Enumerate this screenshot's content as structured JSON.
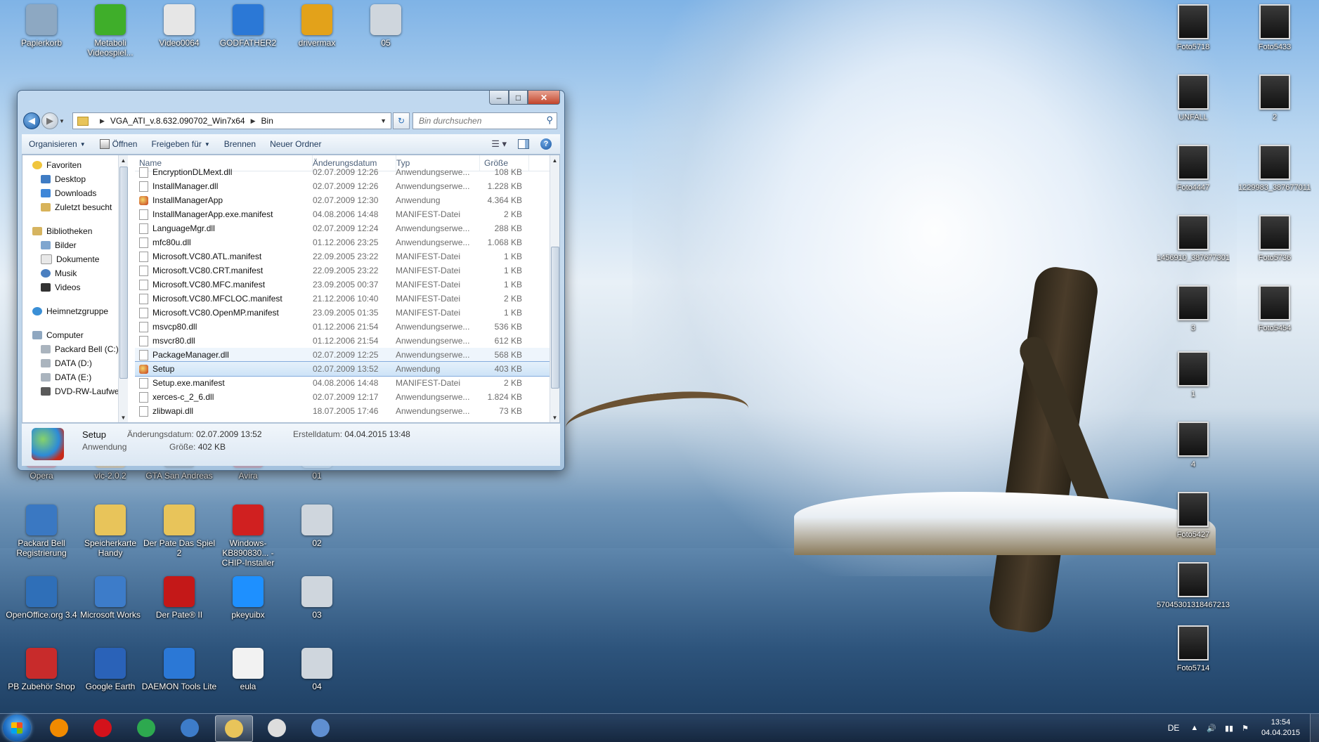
{
  "desktop": {
    "icons_left": [
      {
        "label": "Papierkorb",
        "icon": "recycle-bin-icon",
        "color": "#8da8c2"
      },
      {
        "label": "Metaboli Videospiel...",
        "icon": "metaboli-icon",
        "color": "#3fae2a"
      },
      {
        "label": "Video0064",
        "icon": "video-file-icon",
        "color": "#e6e6e6"
      },
      {
        "label": "GODFATHER2",
        "icon": "lightning-icon",
        "color": "#2b78d6"
      },
      {
        "label": "drivermax",
        "icon": "drivermax-icon",
        "color": "#e3a21a"
      },
      {
        "label": "05",
        "icon": "photo-thumb-icon",
        "color": "#cfd6dd"
      }
    ],
    "icons_mid_hidden": [
      {
        "label": "Opera",
        "icon": "opera-icon",
        "color": "#cc1b1b"
      },
      {
        "label": "vlc-2.0.2",
        "icon": "vlc-icon",
        "color": "#f08a00"
      },
      {
        "label": "GTA San Andreas",
        "icon": "gta-icon",
        "color": "#555555"
      },
      {
        "label": "Avira",
        "icon": "avira-icon",
        "color": "#c21d1d"
      },
      {
        "label": "01",
        "icon": "photo-thumb-icon",
        "color": "#cfd6dd"
      }
    ],
    "icons_row2": [
      {
        "label": "Packard Bell Registrierung",
        "icon": "packard-bell-icon",
        "color": "#3a78c2"
      },
      {
        "label": "Speicherkarte Handy",
        "icon": "folder-icon",
        "color": "#e8c45a"
      },
      {
        "label": "Der Pate Das Spiel 2",
        "icon": "folder-icon",
        "color": "#e8c45a"
      },
      {
        "label": "Windows-KB890830... - CHIP-Installer",
        "icon": "chip-installer-icon",
        "color": "#d02020"
      },
      {
        "label": "02",
        "icon": "photo-thumb-icon",
        "color": "#cfd6dd"
      }
    ],
    "icons_row3": [
      {
        "label": "OpenOffice.org 3.4",
        "icon": "openoffice-icon",
        "color": "#2f6fb8"
      },
      {
        "label": "Microsoft Works",
        "icon": "ms-works-icon",
        "color": "#3d7cc9"
      },
      {
        "label": "Der Pate® II",
        "icon": "der-pate-icon",
        "color": "#c41818"
      },
      {
        "label": "pkeyuibx",
        "icon": "windows-logo-icon",
        "color": "#1e90ff"
      },
      {
        "label": "03",
        "icon": "photo-thumb-icon",
        "color": "#cfd6dd"
      }
    ],
    "icons_row4": [
      {
        "label": "PB Zubehör Shop",
        "icon": "pb-shop-icon",
        "color": "#c82b2b"
      },
      {
        "label": "Google Earth",
        "icon": "google-earth-icon",
        "color": "#2a62b8"
      },
      {
        "label": "DAEMON Tools Lite",
        "icon": "daemon-tools-icon",
        "color": "#2b78d6"
      },
      {
        "label": "eula",
        "icon": "text-file-icon",
        "color": "#f2f2f2"
      },
      {
        "label": "04",
        "icon": "photo-thumb-icon",
        "color": "#cfd6dd"
      }
    ],
    "icons_right": [
      {
        "label": "Foto5718"
      },
      {
        "label": "Foto5433"
      },
      {
        "label": "UNFALL"
      },
      {
        "label": "2"
      },
      {
        "label": "Foto4447"
      },
      {
        "label": "1229983_387677011..."
      },
      {
        "label": "1456910_387677301..."
      },
      {
        "label": "Foto5736"
      },
      {
        "label": "3"
      },
      {
        "label": "Foto5454"
      },
      {
        "label": "1"
      },
      {
        "label": "4"
      },
      {
        "label": "Foto5427"
      },
      {
        "label": "57045301318467213 82"
      },
      {
        "label": "Foto5714"
      }
    ]
  },
  "window": {
    "caption": {
      "minimize": "–",
      "maximize": "□",
      "close": "✕"
    },
    "address": {
      "segments": [
        "VGA_ATI_v.8.632.090702_Win7x64",
        "Bin"
      ]
    },
    "search": {
      "placeholder": "Bin durchsuchen"
    },
    "toolbar": {
      "organize": "Organisieren",
      "open": "Öffnen",
      "share": "Freigeben für",
      "burn": "Brennen",
      "new_folder": "Neuer Ordner"
    },
    "nav": {
      "favorites": "Favoriten",
      "desktop": "Desktop",
      "downloads": "Downloads",
      "recent": "Zuletzt besucht",
      "libraries": "Bibliotheken",
      "pictures": "Bilder",
      "documents": "Dokumente",
      "music": "Musik",
      "videos": "Videos",
      "homegroup": "Heimnetzgruppe",
      "computer": "Computer",
      "drive_c": "Packard Bell (C:)",
      "drive_d": "DATA (D:)",
      "drive_e": "DATA (E:)",
      "drive_dvd": "DVD-RW-Laufwe"
    },
    "columns": {
      "name": "Name",
      "date": "Änderungsdatum",
      "type": "Typ",
      "size": "Größe"
    },
    "files": [
      {
        "name": "EncryptionDLMext.dll",
        "date": "02.07.2009 12:26",
        "type": "Anwendungserwe...",
        "size": "108 KB",
        "icon": "file"
      },
      {
        "name": "InstallManager.dll",
        "date": "02.07.2009 12:26",
        "type": "Anwendungserwe...",
        "size": "1.228 KB",
        "icon": "file"
      },
      {
        "name": "InstallManagerApp",
        "date": "02.07.2009 12:30",
        "type": "Anwendung",
        "size": "4.364 KB",
        "icon": "app"
      },
      {
        "name": "InstallManagerApp.exe.manifest",
        "date": "04.08.2006 14:48",
        "type": "MANIFEST-Datei",
        "size": "2 KB",
        "icon": "file"
      },
      {
        "name": "LanguageMgr.dll",
        "date": "02.07.2009 12:24",
        "type": "Anwendungserwe...",
        "size": "288 KB",
        "icon": "file"
      },
      {
        "name": "mfc80u.dll",
        "date": "01.12.2006 23:25",
        "type": "Anwendungserwe...",
        "size": "1.068 KB",
        "icon": "file"
      },
      {
        "name": "Microsoft.VC80.ATL.manifest",
        "date": "22.09.2005 23:22",
        "type": "MANIFEST-Datei",
        "size": "1 KB",
        "icon": "file"
      },
      {
        "name": "Microsoft.VC80.CRT.manifest",
        "date": "22.09.2005 23:22",
        "type": "MANIFEST-Datei",
        "size": "1 KB",
        "icon": "file"
      },
      {
        "name": "Microsoft.VC80.MFC.manifest",
        "date": "23.09.2005 00:37",
        "type": "MANIFEST-Datei",
        "size": "1 KB",
        "icon": "file"
      },
      {
        "name": "Microsoft.VC80.MFCLOC.manifest",
        "date": "21.12.2006 10:40",
        "type": "MANIFEST-Datei",
        "size": "2 KB",
        "icon": "file"
      },
      {
        "name": "Microsoft.VC80.OpenMP.manifest",
        "date": "23.09.2005 01:35",
        "type": "MANIFEST-Datei",
        "size": "1 KB",
        "icon": "file"
      },
      {
        "name": "msvcp80.dll",
        "date": "01.12.2006 21:54",
        "type": "Anwendungserwe...",
        "size": "536 KB",
        "icon": "file"
      },
      {
        "name": "msvcr80.dll",
        "date": "01.12.2006 21:54",
        "type": "Anwendungserwe...",
        "size": "612 KB",
        "icon": "file"
      },
      {
        "name": "PackageManager.dll",
        "date": "02.07.2009 12:25",
        "type": "Anwendungserwe...",
        "size": "568 KB",
        "icon": "file",
        "state": "hover"
      },
      {
        "name": "Setup",
        "date": "02.07.2009 13:52",
        "type": "Anwendung",
        "size": "403 KB",
        "icon": "app",
        "state": "sel"
      },
      {
        "name": "Setup.exe.manifest",
        "date": "04.08.2006 14:48",
        "type": "MANIFEST-Datei",
        "size": "2 KB",
        "icon": "file"
      },
      {
        "name": "xerces-c_2_6.dll",
        "date": "02.07.2009 12:17",
        "type": "Anwendungserwe...",
        "size": "1.824 KB",
        "icon": "file"
      },
      {
        "name": "zlibwapi.dll",
        "date": "18.07.2005 17:46",
        "type": "Anwendungserwe...",
        "size": "73 KB",
        "icon": "file"
      }
    ],
    "details": {
      "name": "Setup",
      "type": "Anwendung",
      "modified_label": "Änderungsdatum:",
      "modified": "02.07.2009 13:52",
      "size_label": "Größe:",
      "size": "402 KB",
      "created_label": "Erstelldatum:",
      "created": "04.04.2015 13:48"
    }
  },
  "taskbar": {
    "apps": [
      {
        "name": "media-player",
        "color": "#f08a00"
      },
      {
        "name": "opera",
        "color": "#d3121b"
      },
      {
        "name": "chrome",
        "color": "#2da94f"
      },
      {
        "name": "ms-works",
        "color": "#3d7cc9"
      },
      {
        "name": "explorer",
        "color": "#e8c45a",
        "active": true
      },
      {
        "name": "unknown-app",
        "color": "#dddddd"
      },
      {
        "name": "control-panel",
        "color": "#5f8fd1"
      }
    ],
    "tray": {
      "lang": "DE",
      "time": "13:54",
      "date": "04.04.2015"
    }
  }
}
